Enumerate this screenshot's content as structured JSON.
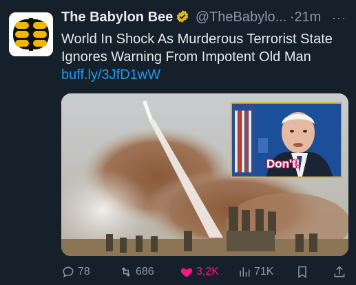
{
  "tweet": {
    "author_name": "The Babylon Bee",
    "handle": "@TheBabylo...",
    "separator": "·",
    "time": "21m",
    "more": "···",
    "text": "World In Shock As Murderous Terrorist State Ignores Warning From Impotent Old Man",
    "link": "buff.ly/3JfD1wW",
    "inset_caption": "Don't!"
  },
  "actions": {
    "replies": "78",
    "retweets": "686",
    "likes": "3,2K",
    "views": "71K"
  },
  "colors": {
    "background": "#15202b",
    "text": "#e7e9ea",
    "muted": "#8b98a5",
    "link": "#1d9bf0",
    "like": "#f91880",
    "verified_gold": "#e2b719"
  },
  "icons": [
    "bee-logo-icon",
    "verified-badge-icon",
    "more-icon",
    "reply-icon",
    "retweet-icon",
    "heart-icon",
    "views-icon",
    "bookmark-icon",
    "share-icon"
  ]
}
